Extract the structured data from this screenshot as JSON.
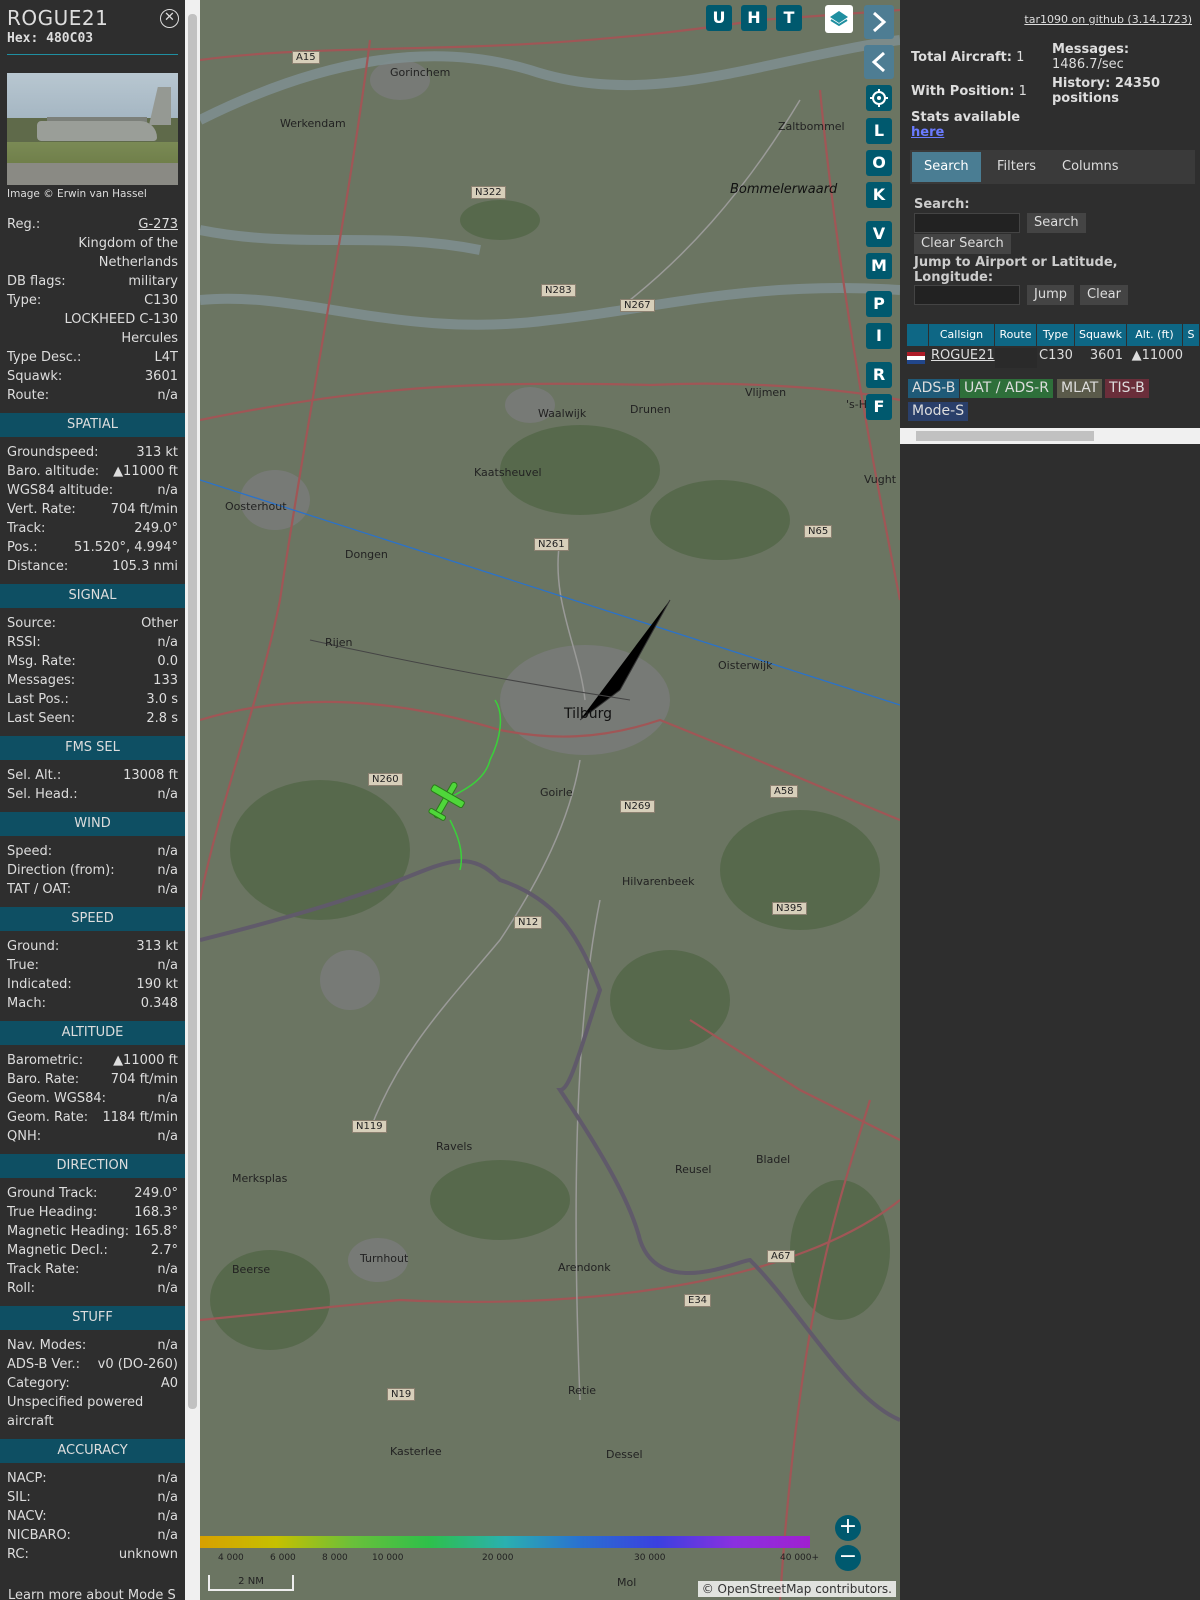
{
  "aircraft": {
    "callsign": "ROGUE21",
    "hex_label": "Hex: 480C03",
    "image_credit": "Image © Erwin van Hassel",
    "info": [
      {
        "k": "Reg.:",
        "v": "G-273",
        "link": true
      },
      {
        "k": "",
        "v": "Kingdom of the Netherlands"
      },
      {
        "k": "DB flags:",
        "v": "military"
      },
      {
        "k": "Type:",
        "v": "C130"
      },
      {
        "k": "",
        "v": "LOCKHEED C-130 Hercules"
      },
      {
        "k": "Type Desc.:",
        "v": "L4T"
      },
      {
        "k": "Squawk:",
        "v": "3601"
      },
      {
        "k": "Route:",
        "v": "n/a"
      }
    ],
    "sections": [
      {
        "title": "SPATIAL",
        "rows": [
          {
            "k": "Groundspeed:",
            "v": "313 kt"
          },
          {
            "k": "Baro. altitude:",
            "v": "▲11000 ft"
          },
          {
            "k": "WGS84 altitude:",
            "v": "n/a"
          },
          {
            "k": "Vert. Rate:",
            "v": "704 ft/min"
          },
          {
            "k": "Track:",
            "v": "249.0°"
          },
          {
            "k": "Pos.:",
            "v": "51.520°, 4.994°"
          },
          {
            "k": "Distance:",
            "v": "105.3 nmi"
          }
        ]
      },
      {
        "title": "SIGNAL",
        "rows": [
          {
            "k": "Source:",
            "v": "Other"
          },
          {
            "k": "RSSI:",
            "v": "n/a"
          },
          {
            "k": "Msg. Rate:",
            "v": "0.0"
          },
          {
            "k": "Messages:",
            "v": "133"
          },
          {
            "k": "Last Pos.:",
            "v": "3.0 s"
          },
          {
            "k": "Last Seen:",
            "v": "2.8 s"
          }
        ]
      },
      {
        "title": "FMS SEL",
        "rows": [
          {
            "k": "Sel. Alt.:",
            "v": "13008 ft"
          },
          {
            "k": "Sel. Head.:",
            "v": "n/a"
          }
        ]
      },
      {
        "title": "WIND",
        "rows": [
          {
            "k": "Speed:",
            "v": "n/a"
          },
          {
            "k": "Direction (from):",
            "v": "n/a"
          },
          {
            "k": "TAT / OAT:",
            "v": "n/a"
          }
        ]
      },
      {
        "title": "SPEED",
        "rows": [
          {
            "k": "Ground:",
            "v": "313 kt"
          },
          {
            "k": "True:",
            "v": "n/a"
          },
          {
            "k": "Indicated:",
            "v": "190 kt"
          },
          {
            "k": "Mach:",
            "v": "0.348"
          }
        ]
      },
      {
        "title": "ALTITUDE",
        "rows": [
          {
            "k": "Barometric:",
            "v": "▲11000 ft"
          },
          {
            "k": "Baro. Rate:",
            "v": "704 ft/min"
          },
          {
            "k": "Geom. WGS84:",
            "v": "n/a"
          },
          {
            "k": "Geom. Rate:",
            "v": "1184 ft/min"
          },
          {
            "k": "QNH:",
            "v": "n/a"
          }
        ]
      },
      {
        "title": "DIRECTION",
        "rows": [
          {
            "k": "Ground Track:",
            "v": "249.0°"
          },
          {
            "k": "True Heading:",
            "v": "168.3°"
          },
          {
            "k": "Magnetic Heading:",
            "v": "165.8°"
          },
          {
            "k": "Magnetic Decl.:",
            "v": "2.7°"
          },
          {
            "k": "Track Rate:",
            "v": "n/a"
          },
          {
            "k": "Roll:",
            "v": "n/a"
          }
        ]
      },
      {
        "title": "STUFF",
        "rows": [
          {
            "k": "Nav. Modes:",
            "v": "n/a"
          },
          {
            "k": "ADS-B Ver.:",
            "v": "v0 (DO-260)"
          },
          {
            "k": "Category:",
            "v": "A0"
          },
          {
            "k": "Unspecified powered aircraft",
            "v": ""
          }
        ]
      },
      {
        "title": "ACCURACY",
        "rows": [
          {
            "k": "NACP:",
            "v": "n/a"
          },
          {
            "k": "SIL:",
            "v": "n/a"
          },
          {
            "k": "NACV:",
            "v": "n/a"
          },
          {
            "k": "NICBARO:",
            "v": "n/a"
          },
          {
            "k": "RC:",
            "v": "unknown"
          }
        ]
      }
    ],
    "footer_note": "Learn more about Mode S data type by hovering over"
  },
  "map": {
    "buttons_top": [
      "U",
      "H",
      "T"
    ],
    "buttons_side": [
      "L",
      "O",
      "K",
      "V",
      "M",
      "P",
      "I",
      "R",
      "F"
    ],
    "towns": [
      "Gorinchem",
      "Werkendam",
      "Zaltbommel",
      "Bommelerwaard",
      "Waalwijk",
      "Drunen",
      "Vlijmen",
      "Kaatsheuvel",
      "Oosterhout",
      "Dongen",
      "Rijen",
      "Tilburg",
      "Oisterwijk",
      "Goirle",
      "Hilvarenbeek",
      "Ravels",
      "Merksplas",
      "Turnhout",
      "Beerse",
      "Arendonk",
      "Reusel",
      "Bladel",
      "Retie",
      "Kasterlee",
      "Dessel",
      "Mol",
      "Vught",
      "'s-H"
    ],
    "roads": [
      "A15",
      "N322",
      "N283",
      "N267",
      "N261",
      "N65",
      "N260",
      "N269",
      "A58",
      "N12",
      "N395",
      "N119",
      "A67",
      "E34",
      "N19"
    ],
    "altitude_ticks": [
      "4 000",
      "6 000",
      "8 000",
      "10 000",
      "20 000",
      "30 000",
      "40 000+"
    ],
    "scale_label": "2 NM",
    "attribution": "© OpenStreetMap contributors."
  },
  "panel": {
    "github_link": "tar1090 on github (3.14.1723)",
    "total_aircraft_label": "Total Aircraft:",
    "total_aircraft": "1",
    "messages_label": "Messages:",
    "messages_value": "1486.7/sec",
    "with_position_label": "With Position:",
    "with_position": "1",
    "history_label": "History: 24350 positions",
    "stats_label": "Stats available",
    "stats_link": "here",
    "tabs": [
      "Search",
      "Filters",
      "Columns"
    ],
    "search_label": "Search:",
    "search_button": "Search",
    "clear_search_button": "Clear Search",
    "jump_label": "Jump to Airport or Latitude, Longitude:",
    "jump_button": "Jump",
    "clear_button": "Clear",
    "columns": [
      "Callsign",
      "Route",
      "Type",
      "Squawk",
      "Alt. (ft)",
      "S"
    ],
    "rows": [
      {
        "callsign": "ROGUE21",
        "route": "",
        "type": "C130",
        "squawk": "3601",
        "alt": "▲11000"
      }
    ],
    "legend": [
      {
        "label": "ADS-B",
        "color": "#1f5a78"
      },
      {
        "label": "UAT / ADS-R",
        "color": "#2e6f3a"
      },
      {
        "label": "MLAT",
        "color": "#5a5a4a"
      },
      {
        "label": "TIS-B",
        "color": "#6a2e3a"
      },
      {
        "label": "Mode-S",
        "color": "#2a3f6a"
      }
    ]
  }
}
